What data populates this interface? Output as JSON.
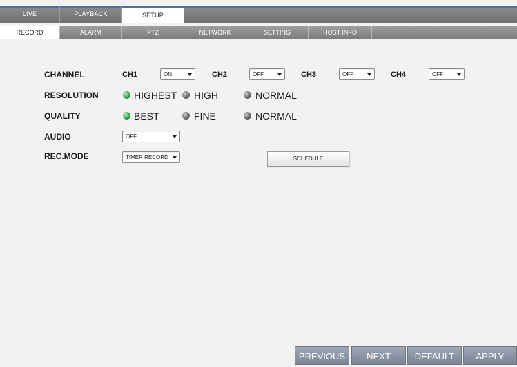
{
  "top_tabs": [
    {
      "label": "LIVE"
    },
    {
      "label": "PLAYBACK"
    },
    {
      "label": "SETUP"
    }
  ],
  "sub_tabs": [
    {
      "label": "RECORD"
    },
    {
      "label": "ALARM"
    },
    {
      "label": "PTZ"
    },
    {
      "label": "NETWORK"
    },
    {
      "label": "SETTING"
    },
    {
      "label": "HOST INFO"
    }
  ],
  "form": {
    "channel": {
      "label": "CHANNEL",
      "channels": [
        {
          "name": "CH1",
          "value": "ON"
        },
        {
          "name": "CH2",
          "value": "OFF"
        },
        {
          "name": "CH3",
          "value": "OFF"
        },
        {
          "name": "CH4",
          "value": "OFF"
        }
      ]
    },
    "resolution": {
      "label": "RESOLUTION",
      "options": [
        {
          "label": "HIGHEST",
          "selected": true
        },
        {
          "label": "HIGH",
          "selected": false
        },
        {
          "label": "NORMAL",
          "selected": false
        }
      ]
    },
    "quality": {
      "label": "QUALITY",
      "options": [
        {
          "label": "BEST",
          "selected": true
        },
        {
          "label": "FINE",
          "selected": false
        },
        {
          "label": "NORMAL",
          "selected": false
        }
      ]
    },
    "audio": {
      "label": "AUDIO",
      "value": "OFF"
    },
    "rec_mode": {
      "label": "REC.MODE",
      "value": "TIMER RECORD",
      "schedule_label": "SCHEDULE"
    }
  },
  "bottom_buttons": {
    "previous": "PREVIOUS",
    "next": "NEXT",
    "default": "DEFAULT",
    "apply": "APPLY"
  },
  "colors": {
    "accent": "#4a6fa5",
    "radio_selected": "#3aa34e",
    "radio_unselected": "#6c6c6c",
    "button": "#8a94a4"
  },
  "icons": {
    "dropdown": "chevron-down-icon",
    "radio_selected": "radio-selected-icon",
    "radio_unselected": "radio-unselected-icon"
  }
}
